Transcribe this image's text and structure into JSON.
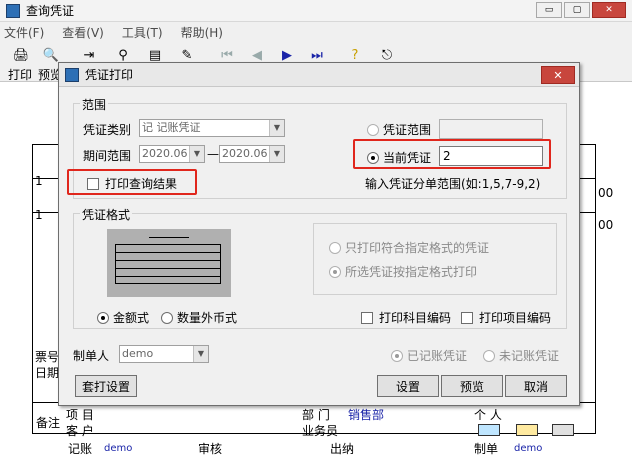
{
  "window": {
    "title": "查询凭证",
    "btn_min": "▭",
    "btn_max": "▢",
    "btn_close": "✕"
  },
  "menu": [
    "文件(F)",
    "查看(V)",
    "工具(T)",
    "帮助(H)"
  ],
  "toolbar": {
    "print_label": "打印",
    "preview_label": "预览"
  },
  "doc": {
    "left_numbers": [
      "1",
      "1"
    ],
    "right_marks": [
      "00",
      "00"
    ],
    "row_label_1": "票号",
    "row_label_2": "日期",
    "notes_label": "备注",
    "project": "项 目",
    "customer": "客 户",
    "dept_label": "部 门",
    "dept_value": "销售部",
    "person": "个 人",
    "salesman": "业务员",
    "footer": {
      "posted": "记账",
      "posted_user": "demo",
      "audit": "审核",
      "cashier": "出纳",
      "maker": "制单",
      "maker_user": "demo"
    }
  },
  "dialog": {
    "title": "凭证打印",
    "close": "✕",
    "scope_group": "范围",
    "voucher_type_label": "凭证类别",
    "voucher_type_value": "记    记账凭证",
    "period_label": "期间范围",
    "period_from": "2020.06",
    "period_to": "2020.06",
    "period_dash": "—",
    "print_query_result": "打印查询结果",
    "voucher_range_label": "凭证范围",
    "current_voucher_label": "当前凭证",
    "current_voucher_value": "2",
    "range_hint": "输入凭证分单范围(如:1,5,7-9,2)",
    "format_group": "凭证格式",
    "only_format_label": "只打印符合指定格式的凭证",
    "selected_format_label": "所选凭证按指定格式打印",
    "amount_style": "金额式",
    "qty_foreign_style": "数量外币式",
    "print_subject_code": "打印科目编码",
    "print_item_code": "打印项目编码",
    "maker_label": "制单人",
    "maker_value": "demo",
    "posted_voucher": "已记账凭证",
    "unposted_voucher": "未记账凭证",
    "print_setup_btn": "套打设置",
    "settings_btn": "设置",
    "preview_btn": "预览",
    "cancel_btn": "取消"
  },
  "colors": {
    "highlight": "#e0261c",
    "blue_text": "#1a24a8",
    "close_btn": "#c8463d"
  }
}
